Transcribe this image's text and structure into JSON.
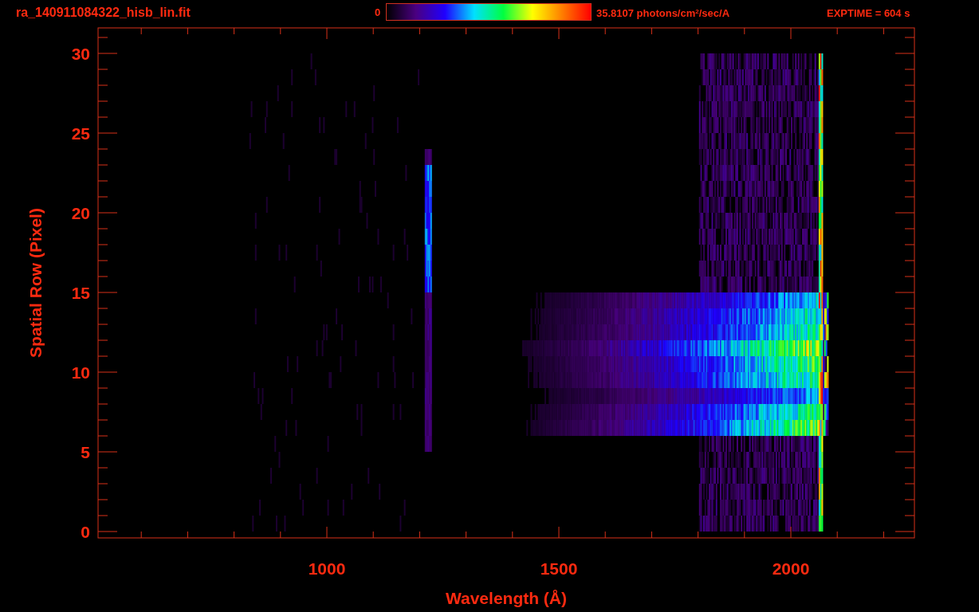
{
  "header": {
    "filename": "ra_140911084322_hisb_lin.fit",
    "exposure": "EXPTIME = 604 s"
  },
  "colorbar": {
    "min_label": "0",
    "max_label": "35.8107 photons/cm$^{2}$/sec/A"
  },
  "plot": {
    "xlabel": "Wavelength (Å)",
    "ylabel": "Spatial Row (Pixel)",
    "xticks": [
      "1000",
      "1500",
      "2000"
    ],
    "yticks": [
      "30",
      "25",
      "20",
      "15",
      "10",
      "5",
      "0"
    ]
  }
}
